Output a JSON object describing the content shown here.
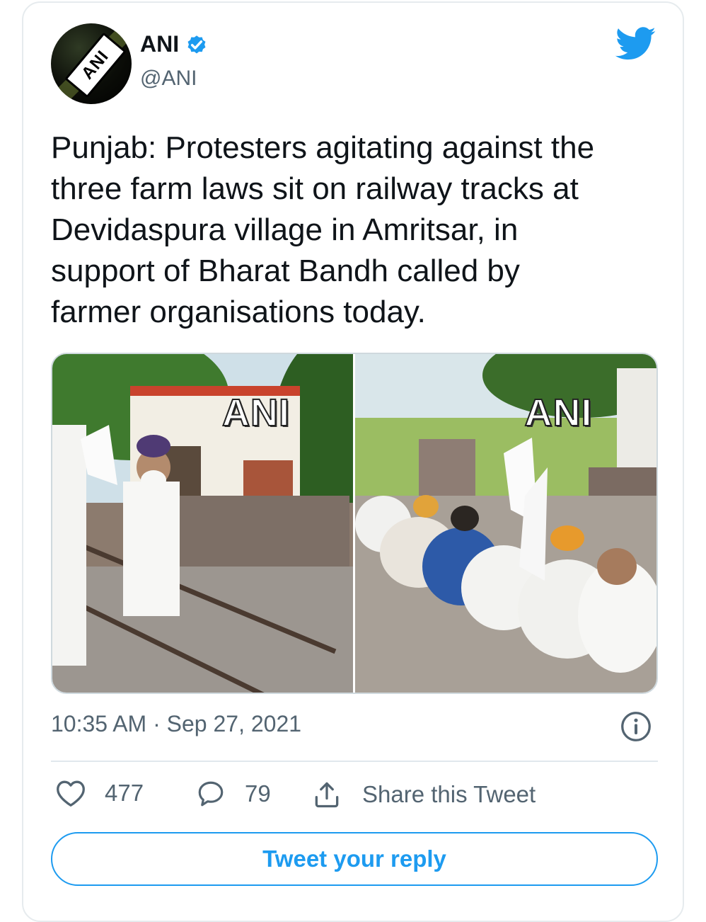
{
  "author": {
    "name": "ANI",
    "handle": "@ANI",
    "avatar_text": "ANI",
    "verified_color": "#1d9bf0"
  },
  "tweet": {
    "text": "Punjab: Protesters agitating against the\nthree farm laws sit on railway tracks at\nDevidaspura village in Amritsar, in\nsupport of Bharat Bandh called by\nfarmer organisations today.",
    "timestamp": "10:35 AM · Sep 27, 2021"
  },
  "media": {
    "left_watermark": "ANI",
    "right_watermark": "ANI"
  },
  "actions": {
    "likes": "477",
    "replies": "79",
    "share_label": "Share this Tweet"
  },
  "reply_button_label": "Tweet your reply",
  "colors": {
    "accent": "#1d9bf0",
    "text": "#0f1419",
    "secondary": "#536471",
    "border": "#e6ebee"
  },
  "icons": [
    "twitter-bird-icon",
    "verified-badge-icon",
    "info-icon",
    "heart-icon",
    "reply-icon",
    "share-icon"
  ]
}
